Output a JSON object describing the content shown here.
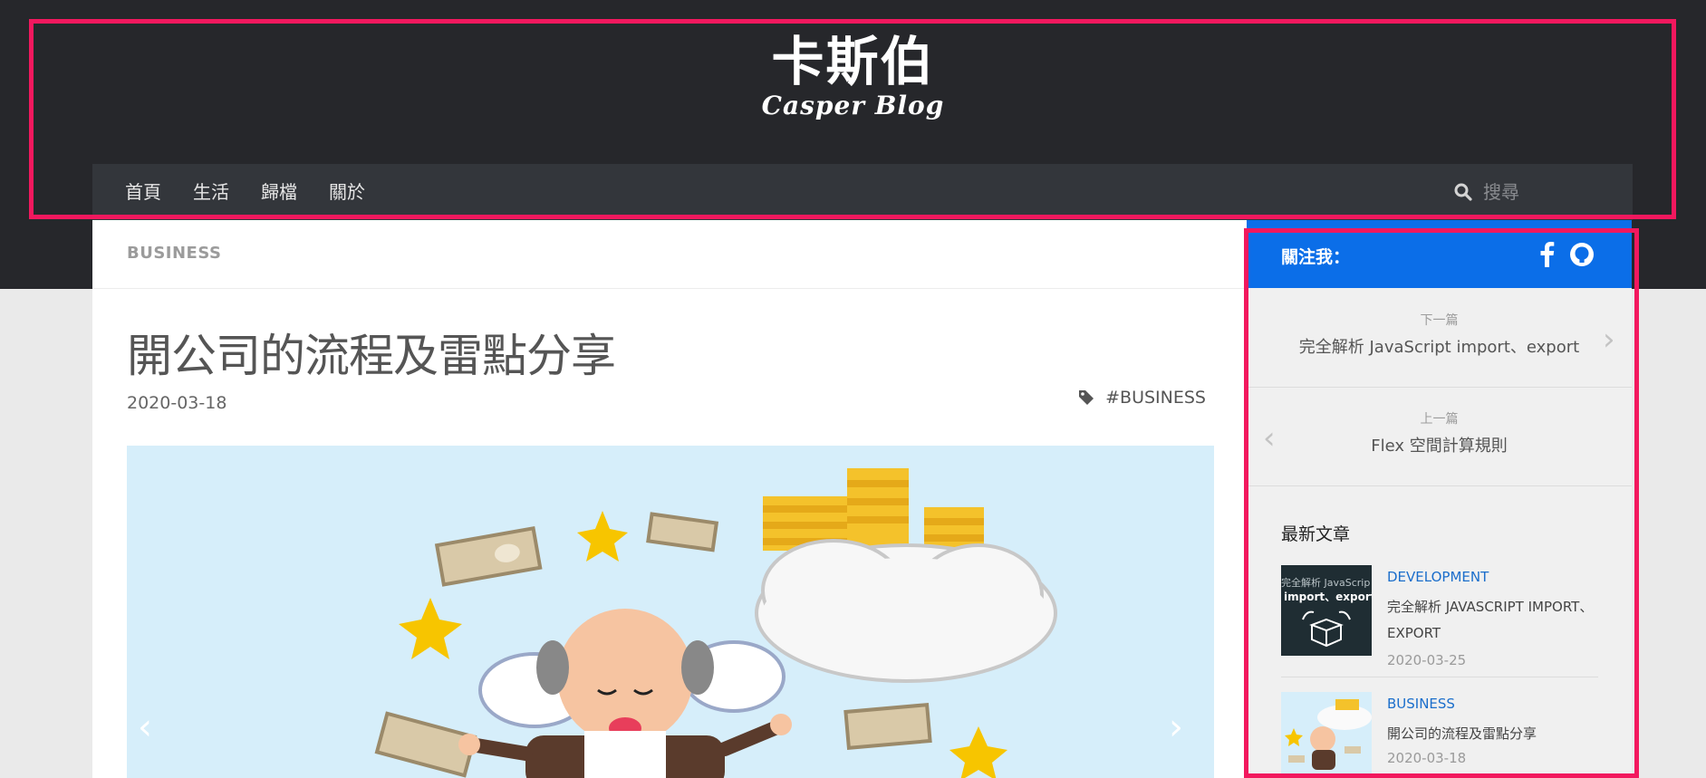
{
  "site": {
    "title": "卡斯伯",
    "subtitle": "Casper Blog"
  },
  "nav": {
    "items": [
      {
        "label": "首頁"
      },
      {
        "label": "生活"
      },
      {
        "label": "歸檔"
      },
      {
        "label": "關於"
      }
    ],
    "search": {
      "placeholder": "搜尋",
      "value": ""
    }
  },
  "post": {
    "category": "BUSINESS",
    "title": "開公司的流程及雷點分享",
    "date": "2020-03-18",
    "tag": "#BUSINESS",
    "hero_icon": "retired-businessman-with-money-illustration"
  },
  "sidebar": {
    "follow": {
      "label": "關注我：",
      "icons": [
        "facebook-icon",
        "github-icon"
      ]
    },
    "next": {
      "label": "下一篇",
      "title": "完全解析 JavaScript import、export"
    },
    "prev": {
      "label": "上一篇",
      "title": "Flex 空間計算規則"
    },
    "recent_heading": "最新文章",
    "recent_posts": [
      {
        "category": "DEVELOPMENT",
        "title": "完全解析 JAVASCRIPT IMPORT、EXPORT",
        "date": "2020-03-25",
        "thumb_text_top": "完全解析 JavaScrip",
        "thumb_text_main": "import、export"
      },
      {
        "category": "BUSINESS",
        "title": "開公司的流程及雷點分享",
        "date": "2020-03-18"
      }
    ]
  },
  "colors": {
    "header_bg": "#26272b",
    "nav_bg": "#33363b",
    "accent_blue": "#0b6ee8",
    "highlight": "#f2185e"
  }
}
